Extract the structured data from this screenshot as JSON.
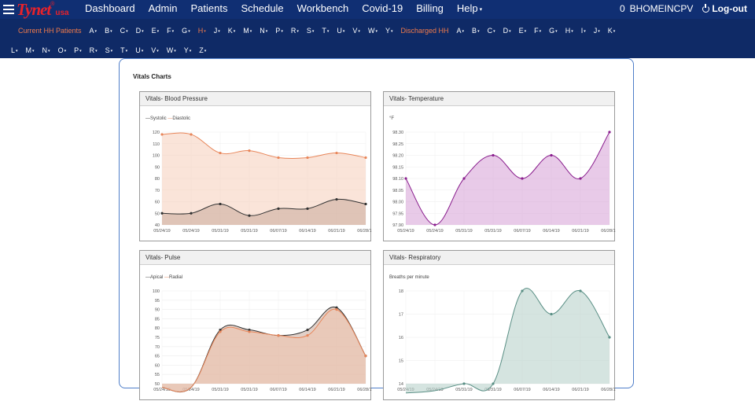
{
  "app": {
    "logo_text": "Tynet",
    "logo_sub": "usa",
    "logo_reg": "®"
  },
  "nav": {
    "items": [
      {
        "label": "Dashboard",
        "caret": false
      },
      {
        "label": "Admin",
        "caret": false
      },
      {
        "label": "Patients",
        "caret": false
      },
      {
        "label": "Schedule",
        "caret": false
      },
      {
        "label": "Workbench",
        "caret": false
      },
      {
        "label": "Covid-19",
        "caret": false
      },
      {
        "label": "Billing",
        "caret": false
      },
      {
        "label": "Help",
        "caret": true
      }
    ],
    "notification_count": "0",
    "username": "BHOMEINCPV",
    "logout_label": "Log-out"
  },
  "patient_letters": {
    "current_label": "Current HH Patients",
    "current_letters": [
      "A",
      "B",
      "C",
      "D",
      "E",
      "F",
      "G",
      "H",
      "J",
      "K",
      "M",
      "N",
      "P",
      "R",
      "S",
      "T",
      "U",
      "V",
      "W",
      "Y"
    ],
    "active_letter": "H",
    "discharged_label": "Discharged HH",
    "discharged_letters_row1": [
      "A",
      "B",
      "C",
      "D",
      "E",
      "F",
      "G",
      "H",
      "I",
      "J",
      "K"
    ],
    "discharged_letters_row2": [
      "L",
      "M",
      "N",
      "O",
      "P",
      "R",
      "S",
      "T",
      "U",
      "V",
      "W",
      "Y",
      "Z"
    ]
  },
  "page": {
    "title": "Vitals Charts"
  },
  "chart_data": [
    {
      "type": "area",
      "title": "Vitals- Blood Pressure",
      "categories": [
        "05/24/19",
        "05/24/19",
        "05/31/19",
        "05/31/19",
        "06/07/19",
        "06/14/19",
        "06/21/19",
        "06/28/19"
      ],
      "series": [
        {
          "name": "Systolic",
          "values": [
            50,
            50,
            58,
            48,
            54,
            54,
            62,
            58
          ],
          "color": "#333333"
        },
        {
          "name": "Diastolic",
          "values": [
            118,
            118,
            102,
            104,
            98,
            98,
            102,
            98
          ],
          "color": "#e8865a"
        }
      ],
      "ylim": [
        40,
        120
      ],
      "yticks": [
        40,
        50,
        60,
        70,
        80,
        90,
        100,
        110,
        120
      ],
      "legend": "top-left",
      "grid": true
    },
    {
      "type": "area",
      "title": "Vitals- Temperature",
      "unit_label": "°F",
      "categories": [
        "05/24/19",
        "05/24/19",
        "05/31/19",
        "05/31/19",
        "06/07/19",
        "06/14/19",
        "06/21/19",
        "06/28/19"
      ],
      "series": [
        {
          "name": "Temperature",
          "values": [
            98.1,
            97.9,
            98.1,
            98.2,
            98.1,
            98.2,
            98.1,
            98.3
          ],
          "color": "#8a1f8e"
        }
      ],
      "ylim": [
        97.9,
        98.3
      ],
      "yticks": [
        97.9,
        97.95,
        98.0,
        98.05,
        98.1,
        98.15,
        98.2,
        98.25,
        98.3
      ],
      "ytick_labels": [
        "97.90",
        "97.95",
        "98.00",
        "98.05",
        "98.10",
        "98.15",
        "98.20",
        "98.25",
        "98.30"
      ],
      "grid": true
    },
    {
      "type": "area",
      "title": "Vitals- Pulse",
      "categories": [
        "05/24/19",
        "05/24/19",
        "05/31/19",
        "05/31/19",
        "06/07/19",
        "06/14/19",
        "06/21/19",
        "06/28/19"
      ],
      "series": [
        {
          "name": "Apical",
          "values": [
            48,
            48,
            79,
            79,
            76,
            79,
            91,
            65
          ],
          "color": "#333333"
        },
        {
          "name": "Radial",
          "values": [
            48,
            48,
            78,
            78,
            76,
            76,
            90,
            65
          ],
          "color": "#e8865a"
        }
      ],
      "ylim": [
        50,
        100
      ],
      "yticks": [
        50,
        55,
        60,
        65,
        70,
        75,
        80,
        85,
        90,
        95,
        100
      ],
      "legend": "top-left",
      "grid": true
    },
    {
      "type": "area",
      "title": "Vitals- Respiratory",
      "unit_label": "Breaths per minute",
      "categories": [
        "05/24/19",
        "05/24/19",
        "05/31/19",
        "05/31/19",
        "06/07/19",
        "06/14/19",
        "06/21/19",
        "06/28/19"
      ],
      "series": [
        {
          "name": "Respiratory",
          "values": [
            13.6,
            13.7,
            14,
            14,
            18,
            17,
            18,
            16
          ],
          "color": "#5a8f85"
        }
      ],
      "ylim": [
        14,
        18
      ],
      "yticks": [
        14,
        15,
        16,
        17,
        18
      ],
      "grid": true
    }
  ]
}
